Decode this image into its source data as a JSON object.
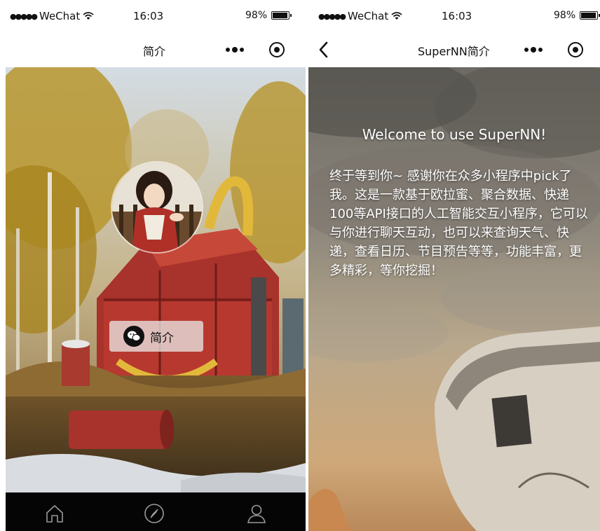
{
  "left_screen": {
    "status": {
      "carrier": "WeChat",
      "time": "16:03",
      "battery": "98%"
    },
    "nav": {
      "title": "简介"
    },
    "intro_button": {
      "label": "简介"
    },
    "tabs": [
      {
        "name": "home",
        "icon": "home-icon"
      },
      {
        "name": "discover",
        "icon": "compass-icon"
      },
      {
        "name": "profile",
        "icon": "user-icon"
      }
    ]
  },
  "right_screen": {
    "status": {
      "carrier": "WeChat",
      "time": "16:03",
      "battery": "98%"
    },
    "nav": {
      "title": "SuperNN简介"
    },
    "welcome": "Welcome to use SuperNN!",
    "description": "终于等到你~ 感谢你在众多小程序中pick了我。这是一款基于欧拉蜜、聚合数据、快递100等API接口的人工智能交互小程序，它可以与你进行聊天互动，也可以来查询天气、快递，查看日历、节目预告等等，功能丰富，更多精彩，等你挖掘！"
  },
  "colors": {
    "tabbar_bg": "#050505",
    "text": "#111111",
    "overlay_text": "#ffffff"
  }
}
